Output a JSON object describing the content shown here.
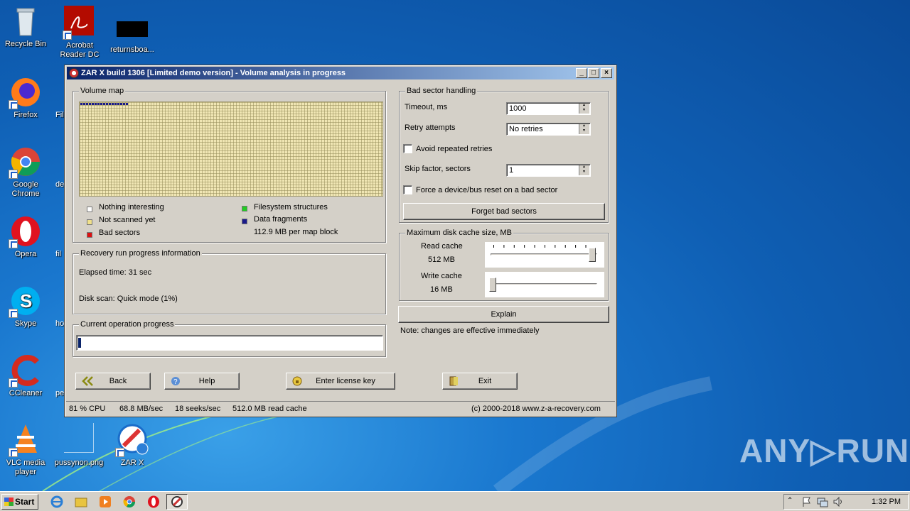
{
  "desktop": {
    "icons": [
      {
        "label": "Recycle Bin",
        "name": "recycle-bin-icon"
      },
      {
        "label": "Acrobat Reader DC",
        "name": "acrobat-reader-icon"
      },
      {
        "label": "returnsboa...",
        "name": "file-icon"
      },
      {
        "label": "Firefox",
        "name": "firefox-icon"
      },
      {
        "label": "Google Chrome",
        "name": "chrome-icon"
      },
      {
        "label": "Opera",
        "name": "opera-icon"
      },
      {
        "label": "Skype",
        "name": "skype-icon"
      },
      {
        "label": "CCleaner",
        "name": "ccleaner-icon"
      },
      {
        "label": "VLC media player",
        "name": "vlc-icon"
      },
      {
        "label": "pussynon.png",
        "name": "image-file-icon"
      },
      {
        "label": "ZAR X",
        "name": "zar-x-icon"
      }
    ],
    "cut_labels": [
      "Fil",
      "de",
      "fil",
      "ho",
      "pe"
    ]
  },
  "window": {
    "title": "ZAR X build 1306 [Limited demo version] - Volume analysis in progress",
    "volume_map": {
      "title": "Volume map",
      "legend": [
        {
          "label": "Nothing interesting",
          "color": "#ffffff"
        },
        {
          "label": "Not scanned yet",
          "color": "#f0e08a"
        },
        {
          "label": "Bad sectors",
          "color": "#dd1111"
        },
        {
          "label": "Filesystem structures",
          "color": "#22cc22"
        },
        {
          "label": "Data fragments",
          "color": "#1a1a8a"
        }
      ],
      "per_block": "112.9 MB per map block"
    },
    "recovery": {
      "title": "Recovery run progress information",
      "elapsed": "Elapsed time: 31 sec",
      "disk_scan": "Disk scan: Quick mode (1%)"
    },
    "current_op": {
      "title": "Current operation progress",
      "progress": 0.01
    },
    "bad_sector": {
      "title": "Bad sector handling",
      "timeout_label": "Timeout, ms",
      "timeout_value": "1000",
      "retry_label": "Retry attempts",
      "retry_value": "No retries",
      "avoid_label": "Avoid repeated retries",
      "skip_label": "Skip factor, sectors",
      "skip_value": "1",
      "reset_label": "Force a device/bus reset on a bad sector",
      "forget_button": "Forget bad sectors"
    },
    "cache": {
      "title": "Maximum disk cache size, MB",
      "read_label": "Read cache",
      "read_value": "512 MB",
      "read_level": 1.0,
      "write_label": "Write cache",
      "write_value": "16 MB",
      "write_level": 0.0,
      "explain_button": "Explain",
      "note": "Note: changes are effective immediately"
    },
    "buttons": {
      "back": "Back",
      "help": "Help",
      "license": "Enter license key",
      "exit": "Exit"
    },
    "status": {
      "cpu": "81 % CPU",
      "speed": "68.8 MB/sec",
      "seeks": "18 seeks/sec",
      "cache": "512.0 MB read cache",
      "copyright": "(c) 2000-2018 www.z-a-recovery.com"
    }
  },
  "taskbar": {
    "start": "Start",
    "clock": "1:32 PM"
  },
  "watermark": "ANY▷RUN"
}
